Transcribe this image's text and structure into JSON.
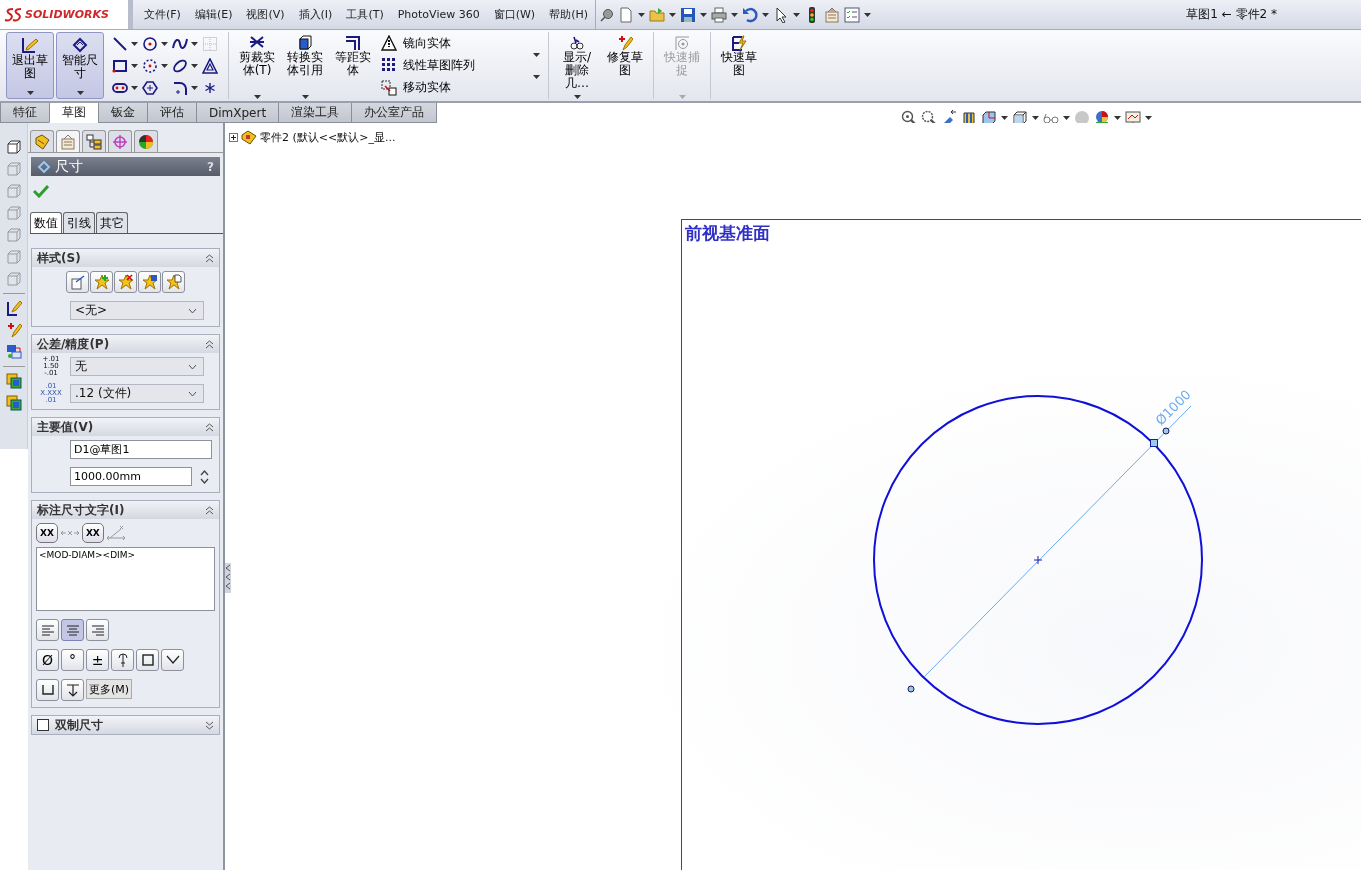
{
  "app": {
    "logo": "SOLIDWORKS",
    "title": "草图1 ← 零件2 *"
  },
  "menu": [
    "文件(F)",
    "编辑(E)",
    "视图(V)",
    "插入(I)",
    "工具(T)",
    "PhotoView 360",
    "窗口(W)",
    "帮助(H)"
  ],
  "command_manager": {
    "large_buttons": [
      {
        "label": "退出草图",
        "selected": true
      },
      {
        "label": "智能尺寸",
        "selected": true
      }
    ],
    "tools": [
      {
        "label": "剪裁实体(T)",
        "kind": "trim"
      },
      {
        "label": "转换实体引用",
        "kind": "convert"
      },
      {
        "label": "等距实体",
        "kind": "offset"
      }
    ],
    "list_tools": [
      {
        "label": "镜向实体",
        "kind": "mirror"
      },
      {
        "label": "线性草图阵列",
        "kind": "pattern"
      },
      {
        "label": "移动实体",
        "kind": "move"
      }
    ],
    "right_tools": [
      {
        "label": "显示/删除几…",
        "kind": "relations",
        "disabled": false
      },
      {
        "label": "修复草图",
        "kind": "repair",
        "disabled": false
      },
      {
        "label": "快速捕捉",
        "kind": "snap",
        "disabled": true
      },
      {
        "label": "快速草图",
        "kind": "quick",
        "disabled": false
      }
    ]
  },
  "tabs": [
    {
      "label": "特征",
      "selected": false
    },
    {
      "label": "草图",
      "selected": true
    },
    {
      "label": "钣金",
      "selected": false
    },
    {
      "label": "评估",
      "selected": false
    },
    {
      "label": "DimXpert",
      "selected": false
    },
    {
      "label": "渲染工具",
      "selected": false
    },
    {
      "label": "办公室产品",
      "selected": false
    }
  ],
  "property_manager": {
    "title": "尺寸",
    "help": "?",
    "tabs": [
      {
        "label": "数值",
        "selected": true
      },
      {
        "label": "引线",
        "selected": false
      },
      {
        "label": "其它",
        "selected": false
      }
    ],
    "sections": [
      {
        "kind": "style",
        "title": "样式(S)",
        "expanded": true,
        "dropdown": "<无>"
      },
      {
        "kind": "tolerance",
        "title": "公差/精度(P)",
        "expanded": true,
        "tolerance_icon": [
          "+.01",
          "1.50",
          "-.01"
        ],
        "tolerance": "无",
        "precision_icon": [
          ".01",
          "X.XXX",
          ".01"
        ],
        "precision": ".12 (文件)"
      },
      {
        "kind": "value",
        "title": "主要值(V)",
        "expanded": true,
        "name": "D1@草图1",
        "value": "1000.00mm"
      },
      {
        "kind": "text",
        "title": "标注尺寸文字(I)",
        "expanded": true,
        "paren_buttons": [
          "XX",
          "XX"
        ],
        "text": "<MOD-DIAM><DIM>",
        "align": [
          {
            "kind": "left",
            "selected": false
          },
          {
            "kind": "center",
            "selected": true
          },
          {
            "kind": "right",
            "selected": false
          }
        ],
        "symbols": [
          {
            "kind": "char",
            "label": "Ø"
          },
          {
            "kind": "char",
            "label": "°"
          },
          {
            "kind": "char",
            "label": "±"
          },
          {
            "kind": "centerline"
          },
          {
            "kind": "square"
          },
          {
            "kind": "countersink"
          },
          {
            "kind": "counterbore"
          },
          {
            "kind": "depth"
          },
          {
            "kind": "more",
            "label": "更多(M)"
          }
        ]
      },
      {
        "kind": "dual",
        "title": "双制尺寸",
        "expanded": false,
        "checked": false
      }
    ]
  },
  "graphics": {
    "tree": {
      "label": "零件2  (默认<<默认>_显...",
      "expanded": false
    },
    "plane": "前视基准面",
    "dimension": "Ø1000"
  }
}
